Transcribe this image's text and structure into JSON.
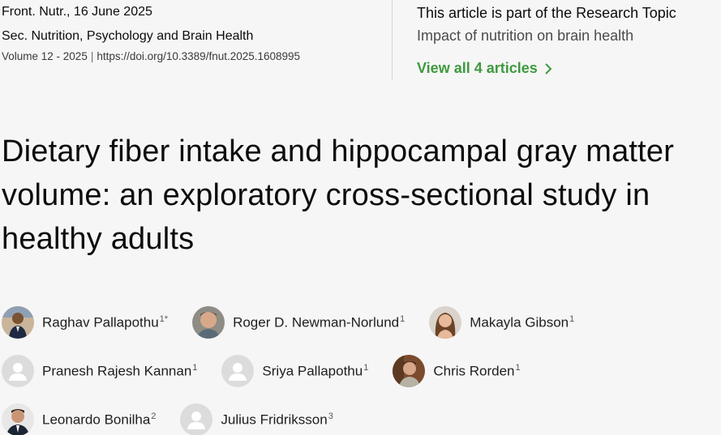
{
  "header": {
    "journal_date": "Front. Nutr., 16 June 2025",
    "section": "Sec. Nutrition, Psychology and Brain Health",
    "volume": "Volume 12 - 2025",
    "separator": "|",
    "doi": "https://doi.org/10.3389/fnut.2025.1608995"
  },
  "research_topic": {
    "heading": "This article is part of the Research Topic",
    "name": "Impact of nutrition on brain health",
    "link_label": "View all 4 articles"
  },
  "title": "Dietary fiber intake and hippocampal gray matter volume: an exploratory cross-sectional study in healthy adults",
  "authors": [
    {
      "name": "Raghav Pallapothu",
      "affiliation": "1*",
      "photo": "photo"
    },
    {
      "name": "Roger D. Newman-Norlund",
      "affiliation": "1",
      "photo": "photo"
    },
    {
      "name": "Makayla Gibson",
      "affiliation": "1",
      "photo": "photo"
    },
    {
      "name": "Pranesh Rajesh Kannan",
      "affiliation": "1",
      "photo": "placeholder"
    },
    {
      "name": "Sriya Pallapothu",
      "affiliation": "1",
      "photo": "placeholder"
    },
    {
      "name": "Chris Rorden",
      "affiliation": "1",
      "photo": "photo"
    },
    {
      "name": "Leonardo Bonilha",
      "affiliation": "2",
      "photo": "photo"
    },
    {
      "name": "Julius Fridriksson",
      "affiliation": "3",
      "photo": "placeholder"
    }
  ],
  "colors": {
    "accent_green": "#3e9a3f",
    "background": "#f6f6f6",
    "placeholder_avatar": "#dcdcdc"
  }
}
